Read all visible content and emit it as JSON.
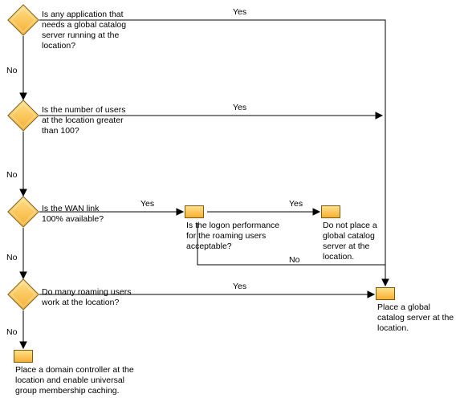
{
  "chart_data": {
    "type": "diagram",
    "title": "",
    "nodes": [
      {
        "id": "d1",
        "kind": "decision",
        "text": "Is any application that needs a global catalog server running at the location?"
      },
      {
        "id": "d2",
        "kind": "decision",
        "text": "Is the number of users at the location greater than 100?"
      },
      {
        "id": "d3",
        "kind": "decision",
        "text": "Is the WAN link 100% available?"
      },
      {
        "id": "d4",
        "kind": "decision",
        "text": "Do many roaming users work at the location?"
      },
      {
        "id": "p1",
        "kind": "process",
        "text": "Is the logon performance for the roaming users acceptable?"
      },
      {
        "id": "p2",
        "kind": "process",
        "text": "Do not place a global catalog server at the location."
      },
      {
        "id": "p3",
        "kind": "process",
        "text": "Place a global catalog server at the location."
      },
      {
        "id": "p4",
        "kind": "process",
        "text": "Place a domain controller at the location and enable universal group membership caching."
      }
    ],
    "edges": [
      {
        "from": "d1",
        "to": "p3",
        "label": "Yes"
      },
      {
        "from": "d1",
        "to": "d2",
        "label": "No"
      },
      {
        "from": "d2",
        "to": "p3",
        "label": "Yes"
      },
      {
        "from": "d2",
        "to": "d3",
        "label": "No"
      },
      {
        "from": "d3",
        "to": "p1",
        "label": "Yes"
      },
      {
        "from": "d3",
        "to": "d4",
        "label": "No"
      },
      {
        "from": "p1",
        "to": "p2",
        "label": "Yes"
      },
      {
        "from": "p1",
        "to": "p3",
        "label": "No"
      },
      {
        "from": "d4",
        "to": "p3",
        "label": "Yes"
      },
      {
        "from": "d4",
        "to": "p4",
        "label": "No"
      }
    ]
  },
  "labels": {
    "yes": "Yes",
    "no": "No"
  },
  "d1": {
    "text": "Is any application that needs a global catalog server running at the location?"
  },
  "d2": {
    "text": "Is the number of users at the location greater than 100?"
  },
  "d3": {
    "text": "Is the WAN link 100% available?"
  },
  "d4": {
    "text": "Do many roaming users work at the location?"
  },
  "p1": {
    "text": "Is the logon performance for the roaming users acceptable?"
  },
  "p2": {
    "text": "Do not place a global catalog server at the location."
  },
  "p3": {
    "text": "Place a global catalog server at the location."
  },
  "p4": {
    "text": "Place a domain controller at the location and enable universal group membership caching."
  }
}
